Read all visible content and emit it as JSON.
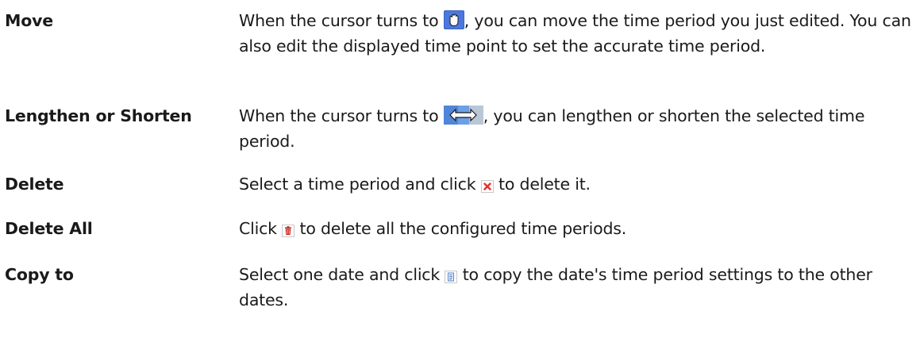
{
  "rows": [
    {
      "term": "Move",
      "before": "When the cursor turns to ",
      "icon": "hand-cursor-icon",
      "after": ", you can move the time period you just edited. You can also edit the displayed time point to set the accurate time period."
    },
    {
      "term": "Lengthen or Shorten",
      "before": "When the cursor turns to ",
      "icon": "resize-arrow-icon",
      "after": ", you can lengthen or shorten the selected time period."
    },
    {
      "term": "Delete",
      "before": "Select a time period and click ",
      "icon": "delete-x-icon",
      "after": " to delete it."
    },
    {
      "term": "Delete All",
      "before": "Click ",
      "icon": "trash-icon",
      "after": " to delete all the configured time periods."
    },
    {
      "term": "Copy to",
      "before": "Select one date and click ",
      "icon": "copy-document-icon",
      "after": " to copy the date's time period settings to the other dates."
    }
  ]
}
